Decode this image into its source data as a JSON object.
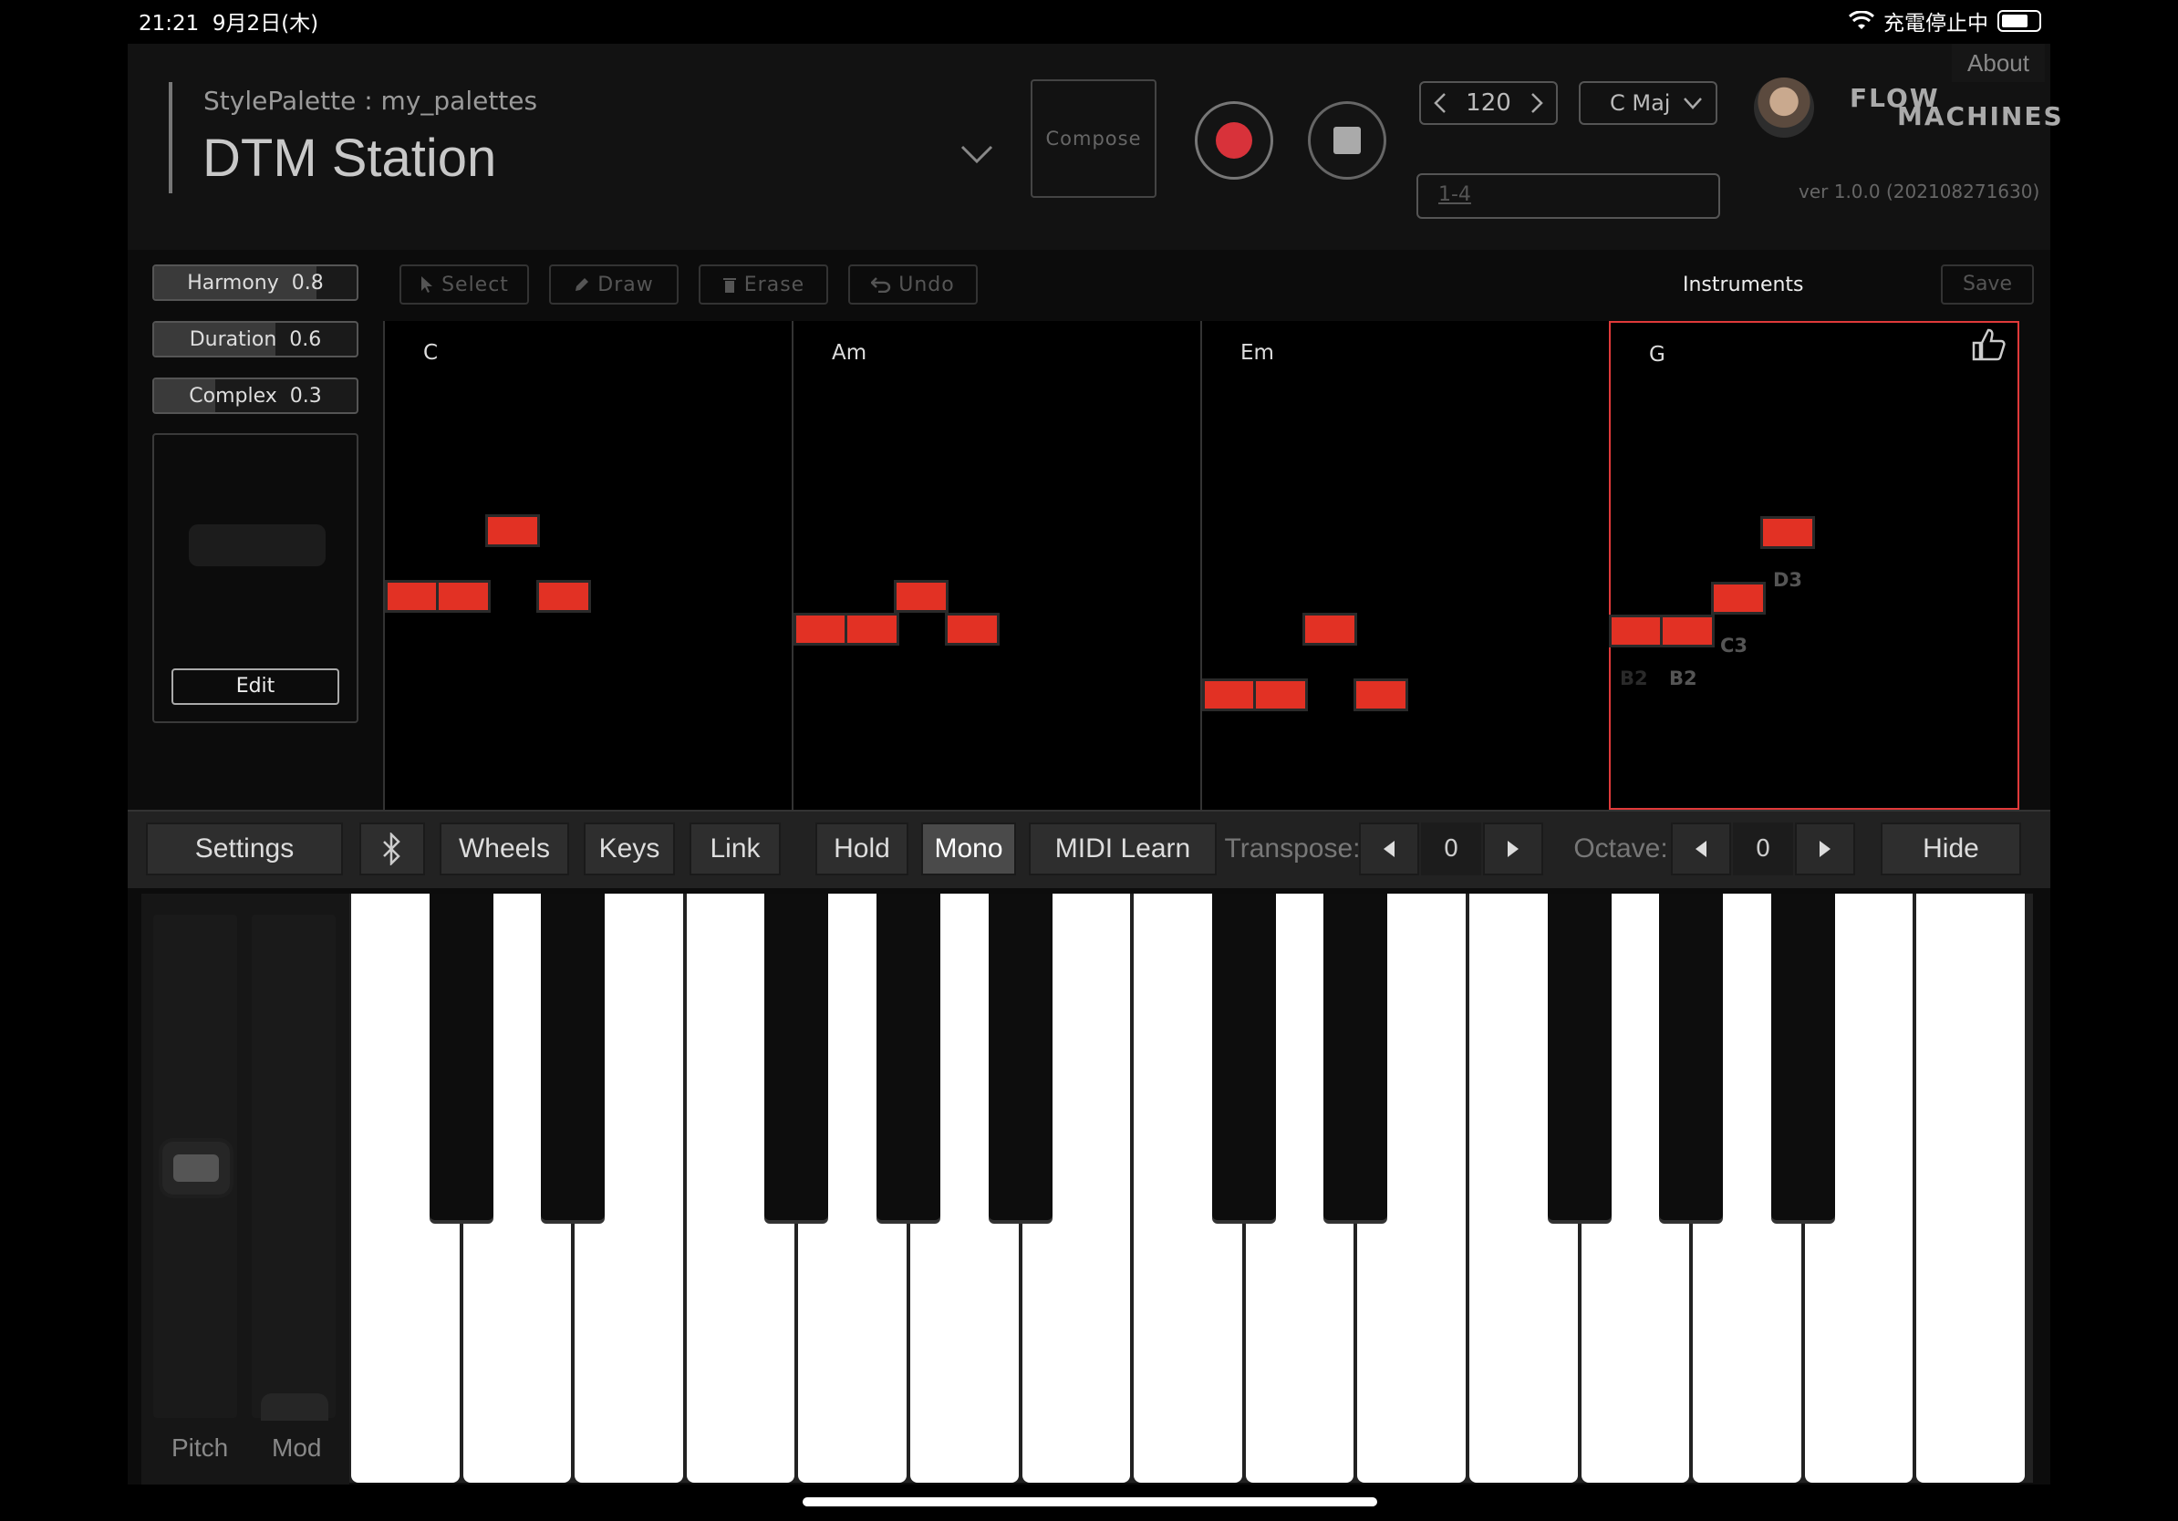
{
  "status_bar": {
    "time": "21:21",
    "date": "9月2日(木)",
    "charging": "充電停止中"
  },
  "header": {
    "palette_label": "StylePalette : my_palettes",
    "title": "DTM Station",
    "compose": "Compose",
    "tempo": "120",
    "key": "C Maj",
    "bar_range": "1-4",
    "logo_line1": "FLOW",
    "logo_line2": "MACHINES",
    "about": "About",
    "version": "ver 1.0.0 (202108271630)"
  },
  "params": [
    {
      "name": "Harmony",
      "value": "0.8",
      "level": 0.8
    },
    {
      "name": "Duration",
      "value": "0.6",
      "level": 0.6
    },
    {
      "name": "Complex",
      "value": "0.3",
      "level": 0.3
    }
  ],
  "style_box": {
    "edit": "Edit"
  },
  "toolbar": {
    "select": "Select",
    "draw": "Draw",
    "erase": "Erase",
    "undo": "Undo",
    "instruments": "Instruments",
    "save": "Save"
  },
  "measures": [
    {
      "chord": "C"
    },
    {
      "chord": "Am"
    },
    {
      "chord": "Em"
    },
    {
      "chord": "G",
      "selected": true,
      "note_labels": [
        "D3",
        "C3",
        "B2",
        "B2"
      ]
    }
  ],
  "keyboard_bar": {
    "settings": "Settings",
    "bluetooth_icon": "bluetooth-icon",
    "wheels": "Wheels",
    "keys": "Keys",
    "link": "Link",
    "hold": "Hold",
    "mono": "Mono",
    "midi_learn": "MIDI Learn",
    "transpose_label": "Transpose:",
    "transpose_value": "0",
    "octave_label": "Octave:",
    "octave_value": "0",
    "hide": "Hide"
  },
  "wheels": {
    "pitch": "Pitch",
    "mod": "Mod"
  },
  "colors": {
    "note": "#e23124",
    "selection": "#e03a3a",
    "record": "#d8323a"
  }
}
